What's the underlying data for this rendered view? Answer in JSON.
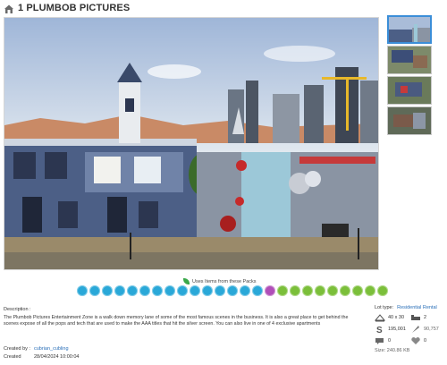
{
  "title": "1 PLUMBOB PICTURES",
  "packs": {
    "label": "Uses Items from these Packs",
    "items": [
      {
        "icon": "pack-icon-1",
        "color": "#2aa8d8"
      },
      {
        "icon": "pack-icon-2",
        "color": "#2aa8d8"
      },
      {
        "icon": "pack-icon-3",
        "color": "#2aa8d8"
      },
      {
        "icon": "pack-icon-4",
        "color": "#2aa8d8"
      },
      {
        "icon": "pack-icon-5",
        "color": "#2aa8d8"
      },
      {
        "icon": "pack-icon-6",
        "color": "#2aa8d8"
      },
      {
        "icon": "pack-icon-7",
        "color": "#2aa8d8"
      },
      {
        "icon": "pack-icon-8",
        "color": "#2aa8d8"
      },
      {
        "icon": "pack-icon-9",
        "color": "#2aa8d8"
      },
      {
        "icon": "pack-icon-10",
        "color": "#2aa8d8"
      },
      {
        "icon": "pack-icon-11",
        "color": "#2aa8d8"
      },
      {
        "icon": "pack-icon-12",
        "color": "#2aa8d8"
      },
      {
        "icon": "pack-icon-13",
        "color": "#2aa8d8"
      },
      {
        "icon": "pack-icon-14",
        "color": "#2aa8d8"
      },
      {
        "icon": "pack-icon-15",
        "color": "#2aa8d8"
      },
      {
        "icon": "pack-icon-16",
        "color": "#b04fb8"
      },
      {
        "icon": "pack-icon-17",
        "color": "#7bbf3a"
      },
      {
        "icon": "pack-icon-18",
        "color": "#7bbf3a"
      },
      {
        "icon": "pack-icon-19",
        "color": "#7bbf3a"
      },
      {
        "icon": "pack-icon-20",
        "color": "#7bbf3a"
      },
      {
        "icon": "pack-icon-21",
        "color": "#7bbf3a"
      },
      {
        "icon": "pack-icon-22",
        "color": "#7bbf3a"
      },
      {
        "icon": "pack-icon-23",
        "color": "#7bbf3a"
      },
      {
        "icon": "pack-icon-24",
        "color": "#7bbf3a"
      },
      {
        "icon": "pack-icon-25",
        "color": "#7bbf3a"
      }
    ]
  },
  "description": {
    "heading": "Description :",
    "text": "The Plumbob Pictures Entertainment Zone is a walk down memory lane of some of the most famous scenes in the business. It is also a great place to get behind the scenes expose of all the pops and tech that are used to make the AAA titles that hit the silver screen.  You can also live in one of 4 exclusive apartments"
  },
  "meta": {
    "created_by_label": "Created by :",
    "created_by_value": "cubrian_cubling",
    "created_label": "Created",
    "created_value": "28/04/2024 10:00:04"
  },
  "lot": {
    "type_label": "Lot type:",
    "type_value": "Residential Rental",
    "size_value": "40 x 30",
    "bedrooms": "2",
    "price": "195,001",
    "value2": "90,757",
    "stat_a": "0",
    "stat_b": "0",
    "file_size": "Size:  240.86 KB"
  }
}
